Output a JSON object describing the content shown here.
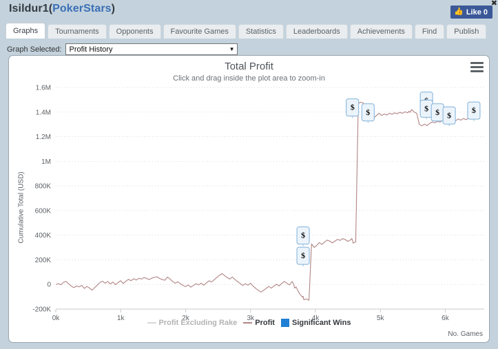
{
  "header": {
    "player_name": "Isildur1",
    "site_open": "(",
    "site_name": "PokerStars",
    "site_close": ")",
    "like_label": "Like 0",
    "thumb_icon": "thumbs-up-icon",
    "close_icon": "✖"
  },
  "tabs": [
    {
      "label": "Graphs",
      "active": true
    },
    {
      "label": "Tournaments",
      "active": false
    },
    {
      "label": "Opponents",
      "active": false
    },
    {
      "label": "Favourite Games",
      "active": false
    },
    {
      "label": "Statistics",
      "active": false
    },
    {
      "label": "Leaderboards",
      "active": false
    },
    {
      "label": "Achievements",
      "active": false
    },
    {
      "label": "Find",
      "active": false
    },
    {
      "label": "Publish",
      "active": false
    }
  ],
  "selector": {
    "label": "Graph Selected:",
    "value": "Profit History",
    "caret": "▼",
    "options": [
      "Profit History"
    ]
  },
  "chart_panel": {
    "menu_icon": "hamburger-menu-icon"
  },
  "chart_data": {
    "type": "line",
    "title": "Total Profit",
    "subtitle": "Click and drag inside the plot area to zoom-in",
    "xlabel": "No. Games",
    "ylabel": "Cumulative Total (USD)",
    "xlim": [
      0,
      6600
    ],
    "ylim": [
      -200000,
      1600000
    ],
    "grid": true,
    "x_ticks": [
      0,
      1000,
      2000,
      3000,
      4000,
      5000,
      6000
    ],
    "x_tick_labels": [
      "0k",
      "1k",
      "2k",
      "3k",
      "4k",
      "5k",
      "6k"
    ],
    "y_ticks": [
      -200000,
      0,
      200000,
      400000,
      600000,
      800000,
      1000000,
      1200000,
      1400000,
      1600000
    ],
    "y_tick_labels": [
      "-200K",
      "0",
      "200K",
      "400K",
      "600K",
      "800K",
      "1M",
      "1.2M",
      "1.4M",
      "1.6M"
    ],
    "legend_position": "bottom",
    "series": [
      {
        "name": "Profit Excluding Rake",
        "color": "#d8d8d8",
        "style": "line",
        "enabled": false,
        "values": []
      },
      {
        "name": "Profit",
        "color": "#b18484",
        "style": "line",
        "enabled": true,
        "x": [
          0,
          40,
          80,
          120,
          160,
          200,
          240,
          280,
          320,
          360,
          400,
          440,
          480,
          520,
          560,
          600,
          640,
          680,
          720,
          760,
          800,
          840,
          880,
          920,
          960,
          1000,
          1040,
          1080,
          1120,
          1160,
          1200,
          1240,
          1280,
          1320,
          1360,
          1400,
          1440,
          1480,
          1520,
          1560,
          1600,
          1640,
          1680,
          1720,
          1760,
          1800,
          1840,
          1880,
          1920,
          1960,
          2000,
          2040,
          2080,
          2120,
          2160,
          2200,
          2240,
          2280,
          2320,
          2360,
          2400,
          2440,
          2480,
          2520,
          2560,
          2600,
          2640,
          2680,
          2720,
          2760,
          2800,
          2840,
          2880,
          2920,
          2960,
          3000,
          3040,
          3080,
          3120,
          3160,
          3200,
          3240,
          3280,
          3320,
          3360,
          3400,
          3440,
          3480,
          3520,
          3560,
          3600,
          3620,
          3640,
          3660,
          3670,
          3680,
          3700,
          3720,
          3740,
          3760,
          3780,
          3800,
          3810,
          3815,
          3820,
          3860,
          3900,
          3940,
          3980,
          4020,
          4060,
          4100,
          4140,
          4180,
          4220,
          4260,
          4300,
          4340,
          4380,
          4420,
          4460,
          4500,
          4540,
          4560,
          4570,
          4575,
          4580,
          4620,
          4660,
          4700,
          4740,
          4780,
          4820,
          4860,
          4900,
          4940,
          4980,
          5020,
          5060,
          5100,
          5140,
          5180,
          5220,
          5260,
          5300,
          5340,
          5380,
          5420,
          5440,
          5460,
          5480,
          5500,
          5520,
          5560,
          5600,
          5640,
          5680,
          5720,
          5760,
          5800,
          5840,
          5880,
          5920,
          5960,
          6000,
          6040,
          6080,
          6120,
          6160,
          6200,
          6240,
          6280,
          6320,
          6360,
          6400,
          6440,
          6480,
          6520
        ],
        "values": [
          0,
          6000,
          -3000,
          18000,
          24000,
          4000,
          -14000,
          -26000,
          -12000,
          -20000,
          -8000,
          -32000,
          -16000,
          -30000,
          -46000,
          -24000,
          -6000,
          16000,
          26000,
          10000,
          24000,
          4000,
          20000,
          -2000,
          16000,
          30000,
          8000,
          26000,
          42000,
          30000,
          46000,
          36000,
          50000,
          44000,
          56000,
          48000,
          40000,
          52000,
          58000,
          62000,
          48000,
          40000,
          34000,
          60000,
          44000,
          24000,
          10000,
          22000,
          6000,
          -8000,
          -18000,
          -4000,
          -22000,
          -8000,
          6000,
          -4000,
          10000,
          -6000,
          12000,
          30000,
          20000,
          38000,
          56000,
          74000,
          88000,
          72000,
          56000,
          44000,
          60000,
          40000,
          24000,
          8000,
          -8000,
          6000,
          -6000,
          10000,
          -14000,
          -32000,
          -48000,
          -62000,
          -48000,
          -32000,
          -16000,
          -30000,
          -14000,
          2000,
          -12000,
          8000,
          24000,
          10000,
          -4000,
          10000,
          24000,
          6000,
          -10000,
          -30000,
          -20000,
          -40000,
          -60000,
          -78000,
          -90000,
          -104000,
          -96000,
          -110000,
          -124000,
          -118000,
          -128000,
          330000,
          300000,
          318000,
          340000,
          326000,
          344000,
          360000,
          352000,
          338000,
          352000,
          366000,
          358000,
          372000,
          364000,
          350000,
          362000,
          372000,
          362000,
          348000,
          336000,
          346000,
          1470000,
          1480000,
          1472000,
          1440000,
          1400000,
          1370000,
          1352000,
          1372000,
          1390000,
          1372000,
          1384000,
          1376000,
          1390000,
          1382000,
          1394000,
          1386000,
          1398000,
          1390000,
          1402000,
          1394000,
          1406000,
          1398000,
          1420000,
          1412000,
          1400000,
          1390000,
          1300000,
          1288000,
          1302000,
          1290000,
          1308000,
          1320000,
          1312000,
          1328000,
          1318000,
          1332000,
          1322000,
          1336000,
          1326000,
          1340000,
          1330000,
          1344000,
          1334000,
          1348000,
          1338000,
          1352000,
          1342000,
          1356000,
          1346000,
          1358000,
          1350000,
          1360000
        ]
      },
      {
        "name": "Significant Wins",
        "color": "#1f7fd4",
        "style": "marker",
        "enabled": true,
        "markers": [
          {
            "x": 3810,
            "y": 400000,
            "label": "$"
          },
          {
            "x": 3810,
            "y": 235000,
            "label": "$"
          },
          {
            "x": 4570,
            "y": 1440000,
            "label": "$"
          },
          {
            "x": 4810,
            "y": 1400000,
            "label": "$"
          },
          {
            "x": 5710,
            "y": 1495000,
            "label": "$"
          },
          {
            "x": 5710,
            "y": 1430000,
            "label": "$"
          },
          {
            "x": 5880,
            "y": 1400000,
            "label": "$"
          },
          {
            "x": 6060,
            "y": 1375000,
            "label": "$"
          },
          {
            "x": 6440,
            "y": 1415000,
            "label": "$"
          }
        ]
      }
    ]
  }
}
